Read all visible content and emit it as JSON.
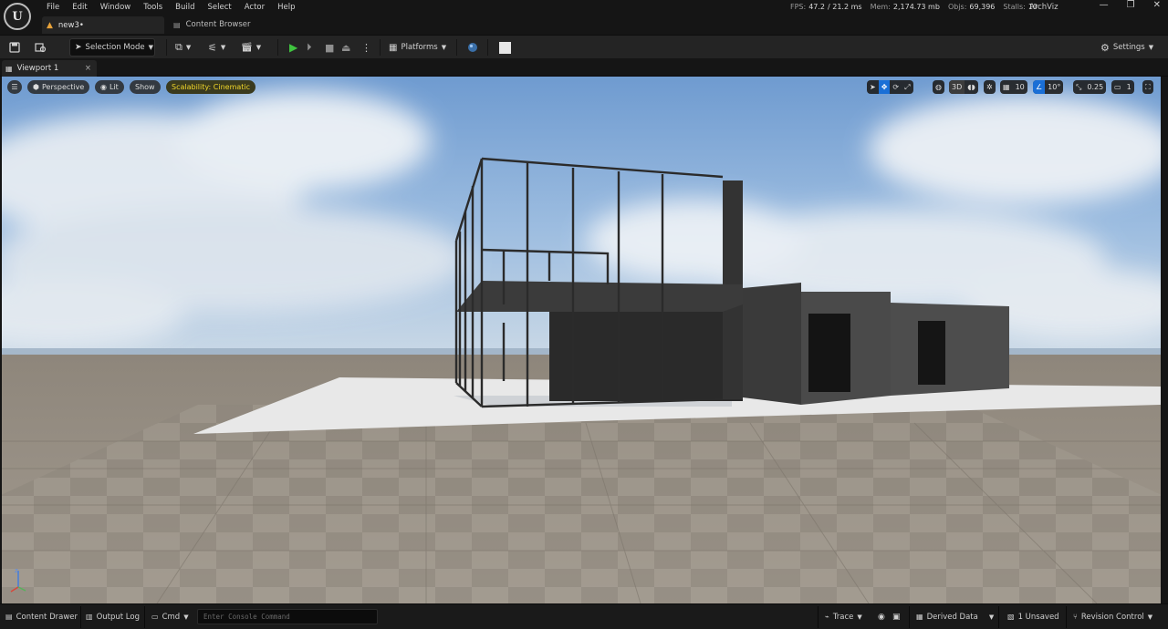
{
  "menubar": {
    "logo": "U",
    "items": [
      "File",
      "Edit",
      "Window",
      "Tools",
      "Build",
      "Select",
      "Actor",
      "Help"
    ],
    "doc_tab": "new3•",
    "content_browser_tab": "Content Browser",
    "stats": {
      "fps_label": "FPS:",
      "fps": "47.2",
      "ms": "/ 21.2 ms",
      "mem_label": "Mem:",
      "mem": "2,174.73 mb",
      "objs_label": "Objs:",
      "objs": "69,396",
      "stalls_label": "Stalls:",
      "stalls": "10"
    },
    "project": "ArchViz",
    "window_controls": [
      "—",
      "❐",
      "✕"
    ]
  },
  "toolbar": {
    "selection_mode": "Selection Mode",
    "platforms": "Platforms",
    "settings": "Settings"
  },
  "viewport_tab": {
    "label": "Viewport 1",
    "close": "×"
  },
  "viewport": {
    "perspective": "Perspective",
    "lit": "Lit",
    "show": "Show",
    "scalability": "Scalability: Cinematic",
    "mode_3d": "3D",
    "grid_snap": "10",
    "rot_snap": "10°",
    "scale_snap": "0.25",
    "camera_speed": "1",
    "gizmo_z": "z"
  },
  "statusbar": {
    "content_drawer": "Content Drawer",
    "output_log": "Output Log",
    "cmd": "Cmd",
    "console_placeholder": "Enter Console Command",
    "trace": "Trace",
    "derived_data": "Derived Data",
    "unsaved": "1 Unsaved",
    "revision_control": "Revision Control"
  },
  "colors": {
    "accent_blue": "#1a6fd6",
    "play_green": "#3fc43f",
    "scalability_yellow": "#f0d62a"
  }
}
